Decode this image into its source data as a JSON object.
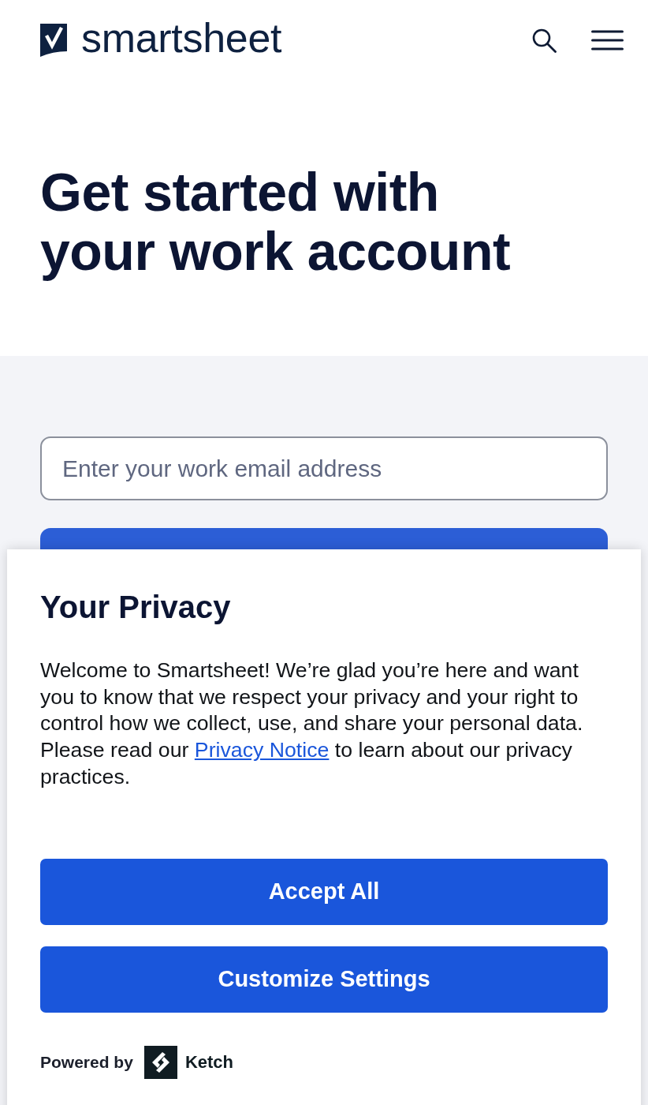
{
  "header": {
    "logo_text": "smartsheet"
  },
  "hero": {
    "heading": "Get started with your work account"
  },
  "signup": {
    "email_field": {
      "placeholder": "Enter your work email address"
    }
  },
  "privacy_dialog": {
    "title": "Your Privacy",
    "body": {
      "text_before": "Welcome to Smartsheet! We’re glad you’re here and want you to know that we respect your privacy and your right to control how we collect, use, and share your personal data. Please read our ",
      "link": "Privacy Notice",
      "text_after": " to learn about our privacy practices."
    },
    "buttons": [
      {
        "label": "Accept All"
      },
      {
        "label": "Customize Settings"
      }
    ],
    "powered_by": {
      "label": "Powered by",
      "brand": "Ketch"
    }
  }
}
